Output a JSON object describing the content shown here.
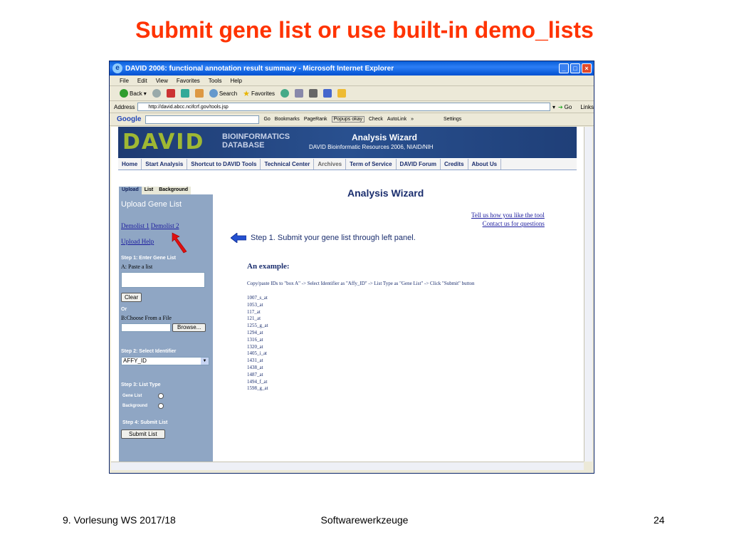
{
  "slide": {
    "title": "Submit gene list or use built-in demo_lists",
    "footer_left": "9. Vorlesung WS 2017/18",
    "footer_center": "Softwarewerkzeuge",
    "footer_right": "24"
  },
  "window": {
    "title": "DAVID 2006: functional annotation result summary - Microsoft Internet Explorer",
    "menu": [
      "File",
      "Edit",
      "View",
      "Favorites",
      "Tools",
      "Help"
    ],
    "toolbar": {
      "back": "Back",
      "search": "Search",
      "favorites": "Favorites"
    },
    "address_label": "Address",
    "address_value": "http://david.abcc.ncifcrf.gov/tools.jsp",
    "go_label": "Go",
    "links_label": "Links",
    "google": {
      "label": "Google",
      "go": "Go",
      "bookmarks": "Bookmarks",
      "pagerank": "PageRank",
      "popups": "Popups okay",
      "check": "Check",
      "autolink": "AutoLink",
      "settings": "Settings"
    }
  },
  "page": {
    "banner": {
      "logo": "DAVID",
      "bio": "BIOINFORMATICS",
      "db": "DATABASE",
      "title": "Analysis Wizard",
      "subtitle": "DAVID Bioinformatic Resources 2006, NIAID/NIH"
    },
    "nav": [
      "Home",
      "Start Analysis",
      "Shortcut to DAVID Tools",
      "Technical Center",
      "Archives",
      "Term of Service",
      "DAVID Forum",
      "Credits",
      "About Us"
    ],
    "panel": {
      "tabs": [
        "Upload",
        "List",
        "Background"
      ],
      "title": "Upload Gene List",
      "demolist1": "Demolist 1",
      "demolist2": "Demolist 2",
      "upload_help": "Upload Help",
      "step1": "Step 1: Enter Gene List",
      "paste": "A: Paste a list",
      "clear": "Clear",
      "or": "Or",
      "choose_file": "B:Choose From a File",
      "browse": "Browse...",
      "step2": "Step 2: Select Identifier",
      "identifier": "AFFY_ID",
      "step3": "Step 3: List Type",
      "gene_list": "Gene List",
      "background": "Background",
      "step4": "Step 4: Submit List",
      "submit": "Submit List"
    },
    "main": {
      "title": "Analysis Wizard",
      "tell_us": "Tell us how you like the tool",
      "contact": "Contact us for questions",
      "step1": "Step 1. Submit your gene list through left panel.",
      "example_heading": "An example:",
      "copypaste": "Copy/paste IDs to \"box A\" -> Select Identifier as \"Affy_ID\" -> List Type as \"Gene List\" -> Click \"Submit\" button",
      "ids": [
        "1007_s_at",
        "1053_at",
        "117_at",
        "121_at",
        "1255_g_at",
        "1294_at",
        "1316_at",
        "1320_at",
        "1405_i_at",
        "1431_at",
        "1438_at",
        "1487_at",
        "1494_f_at",
        "1598_g_at"
      ]
    }
  }
}
